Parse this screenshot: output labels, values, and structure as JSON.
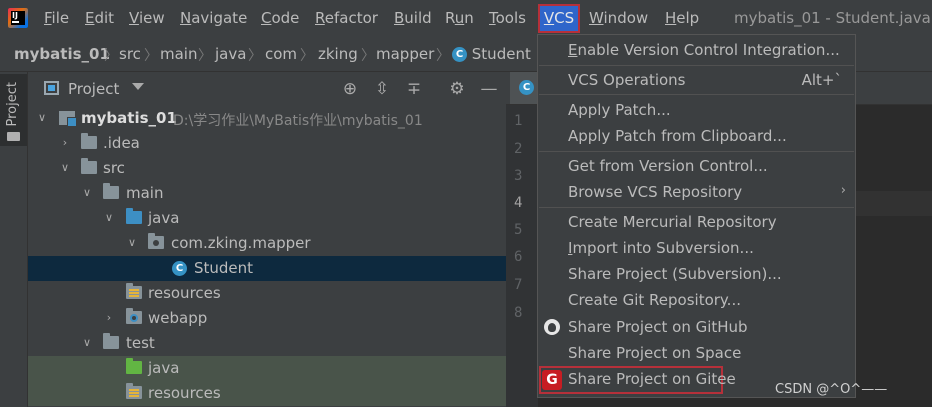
{
  "menubar": {
    "items": [
      {
        "pre": "",
        "u": "F",
        "post": "ile"
      },
      {
        "pre": "",
        "u": "E",
        "post": "dit"
      },
      {
        "pre": "",
        "u": "V",
        "post": "iew"
      },
      {
        "pre": "",
        "u": "N",
        "post": "avigate"
      },
      {
        "pre": "",
        "u": "C",
        "post": "ode"
      },
      {
        "pre": "",
        "u": "R",
        "post": "efactor"
      },
      {
        "pre": "",
        "u": "B",
        "post": "uild"
      },
      {
        "pre": "R",
        "u": "u",
        "post": "n"
      },
      {
        "pre": "",
        "u": "T",
        "post": "ools"
      },
      {
        "pre": "",
        "u": "V",
        "post": "CS"
      },
      {
        "pre": "",
        "u": "W",
        "post": "indow"
      },
      {
        "pre": "",
        "u": "H",
        "post": "elp"
      }
    ],
    "window_title": "mybatis_01 - Student.java"
  },
  "breadcrumb": [
    "mybatis_01",
    "src",
    "main",
    "java",
    "com",
    "zking",
    "mapper",
    "Student"
  ],
  "toolstrip": {
    "project_label": "Project"
  },
  "project_panel": {
    "title": "Project",
    "rows": [
      {
        "label": "mybatis_01",
        "path": "D:\\学习作业\\MyBatis作业\\mybatis_01"
      },
      {
        "label": ".idea"
      },
      {
        "label": "src"
      },
      {
        "label": "main"
      },
      {
        "label": "java"
      },
      {
        "label": "com.zking.mapper"
      },
      {
        "label": "Student"
      },
      {
        "label": "resources"
      },
      {
        "label": "webapp"
      },
      {
        "label": "test"
      },
      {
        "label": "java"
      },
      {
        "label": "resources"
      }
    ]
  },
  "editor": {
    "line_numbers": [
      "1",
      "2",
      "3",
      "4",
      "5",
      "6",
      "7",
      "8"
    ],
    "current_line": "4"
  },
  "vcs_menu": {
    "items": [
      {
        "pre": "",
        "u": "E",
        "post": "nable Version Control Integration..."
      },
      {
        "pre": "VCS Operations",
        "u": "",
        "post": "",
        "shortcut": "Alt+`"
      },
      {
        "pre": "Apply Patch...",
        "u": "",
        "post": ""
      },
      {
        "pre": "Apply Patch from Clipboard...",
        "u": "",
        "post": ""
      },
      {
        "pre": "Get from Version Control...",
        "u": "",
        "post": ""
      },
      {
        "pre": "Browse VCS Repository",
        "u": "",
        "post": ""
      },
      {
        "pre": "Create Mercurial Repository",
        "u": "",
        "post": ""
      },
      {
        "pre": "",
        "u": "I",
        "post": "mport into Subversion..."
      },
      {
        "pre": "Share Project (Subversion)...",
        "u": "",
        "post": ""
      },
      {
        "pre": "Create Git Repository...",
        "u": "",
        "post": ""
      },
      {
        "pre": "Share Project on GitHub",
        "u": "",
        "post": ""
      },
      {
        "pre": "Share Project on Space",
        "u": "",
        "post": ""
      },
      {
        "pre": "Share Project on Gitee",
        "u": "",
        "post": ""
      }
    ]
  },
  "watermark": "CSDN @^O^——",
  "colors": {
    "accent": "#2f65ca",
    "highlight_border": "#b6303a",
    "selection": "#0d293e",
    "gitee": "#c71d23"
  },
  "icons": [
    "intellij-logo-icon",
    "class-c-icon",
    "project-view-icon",
    "dropdown-caret-icon",
    "locate-icon",
    "expand-all-icon",
    "collapse-all-icon",
    "gear-icon",
    "minimize-icon",
    "chevron-right-icon",
    "chevron-down-icon",
    "folder-icon",
    "package-icon",
    "resources-folder-icon",
    "web-folder-icon",
    "module-icon",
    "github-icon",
    "gitee-icon"
  ]
}
